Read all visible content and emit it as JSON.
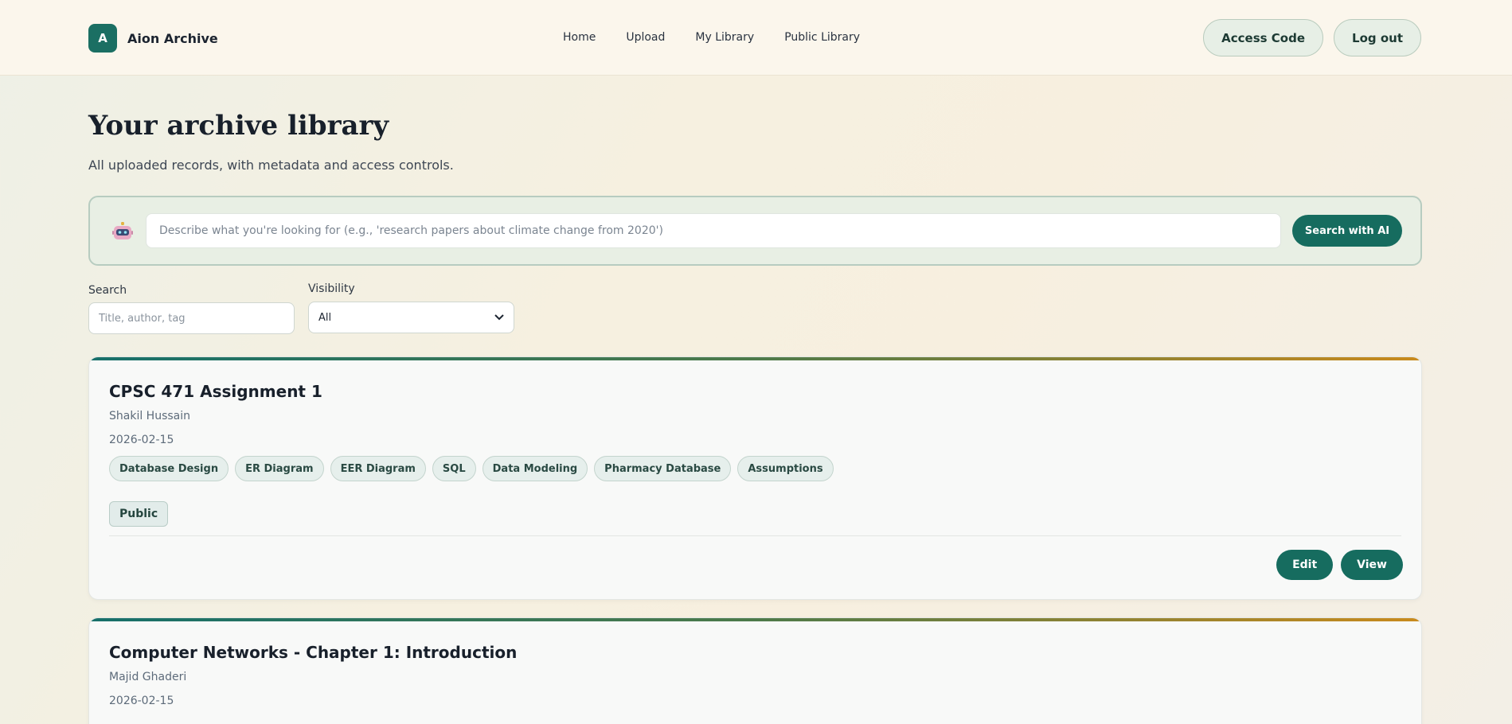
{
  "header": {
    "brand_letter": "A",
    "brand_name": "Aion Archive",
    "nav": [
      "Home",
      "Upload",
      "My Library",
      "Public Library"
    ],
    "access_code_label": "Access Code",
    "logout_label": "Log out"
  },
  "hero": {
    "title": "Your archive library",
    "subtitle": "All uploaded records, with metadata and access controls."
  },
  "ai_search": {
    "icon": "robot-icon",
    "placeholder": "Describe what you're looking for (e.g., 'research papers about climate change from 2020')",
    "button_label": "Search with AI"
  },
  "filters": {
    "search_label": "Search",
    "search_placeholder": "Title, author, tag",
    "visibility_label": "Visibility",
    "visibility_value": "All"
  },
  "records": [
    {
      "title": "CPSC 471 Assignment 1",
      "author": "Shakil Hussain",
      "date": "2026-02-15",
      "tags": [
        "Database Design",
        "ER Diagram",
        "EER Diagram",
        "SQL",
        "Data Modeling",
        "Pharmacy Database",
        "Assumptions"
      ],
      "visibility": "Public",
      "edit_label": "Edit",
      "view_label": "View"
    },
    {
      "title": "Computer Networks - Chapter 1: Introduction",
      "author": "Majid Ghaderi",
      "date": "2026-02-15"
    }
  ],
  "colors": {
    "accent": "#166c5f",
    "accent_gradient_end": "#c98a1d"
  }
}
